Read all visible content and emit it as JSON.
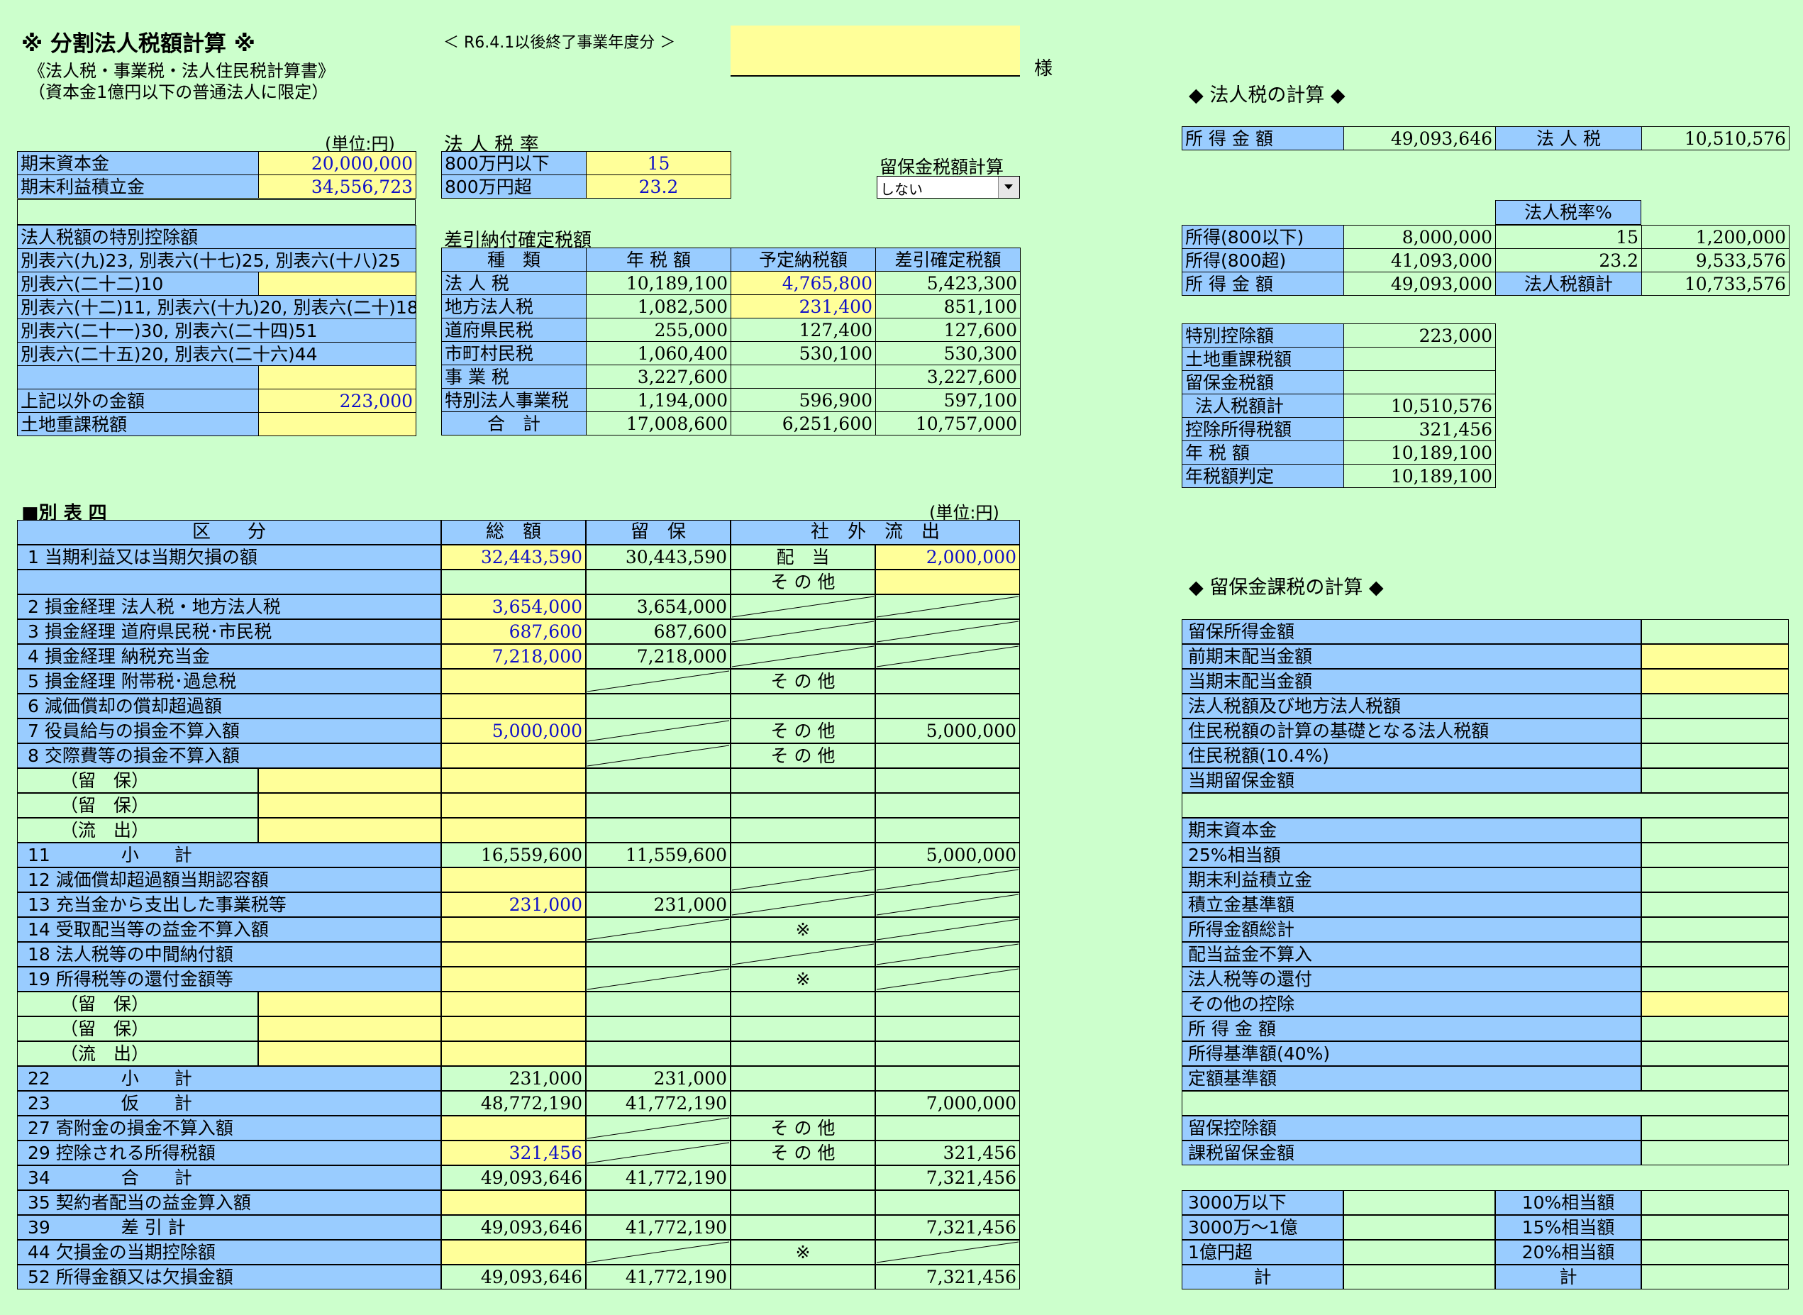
{
  "header": {
    "title": "※ 分割法人税額計算 ※",
    "subtitle1": "《法人税・事業税・法人住民税計算書》",
    "subtitle2": "（資本金1億円以下の普通法人に限定）",
    "period": "＜ R6.4.1以後終了事業年度分 ＞",
    "company_name": "",
    "honorific": "様"
  },
  "capital": {
    "unit": "(単位:円)",
    "rows": [
      {
        "label": "期末資本金",
        "value": "20,000,000"
      },
      {
        "label": "期末利益積立金",
        "value": "34,556,723"
      }
    ]
  },
  "special_deduction": {
    "title": "法人税額の特別控除額",
    "rows": [
      {
        "label": "別表六(九)23, 別表六(十七)25, 別表六(十八)25",
        "value": ""
      },
      {
        "label": "別表六(二十二)10",
        "value": ""
      },
      {
        "label": "別表六(十二)11, 別表六(十九)20, 別表六(二十)18",
        "value": ""
      },
      {
        "label": "別表六(二十一)30, 別表六(二十四)51",
        "value": ""
      },
      {
        "label": "別表六(二十五)20, 別表六(二十六)44",
        "value": ""
      },
      {
        "label": "",
        "value": ""
      },
      {
        "label": "上記以外の金額",
        "value": "223,000"
      },
      {
        "label": "土地重課税額",
        "value": ""
      }
    ]
  },
  "tax_rate": {
    "title": "法 人 税 率",
    "rows": [
      {
        "label": "800万円以下",
        "value": "15"
      },
      {
        "label": "800万円超",
        "value": "23.2"
      }
    ]
  },
  "retained_select": {
    "label": "留保金税額計算",
    "value": "しない"
  },
  "net_tax": {
    "title": "差引納付確定税額",
    "headers": [
      "種　類",
      "年 税 額",
      "予定納税額",
      "差引確定税額"
    ],
    "rows": [
      [
        "法 人 税",
        "10,189,100",
        "4,765,800",
        "5,423,300"
      ],
      [
        "地方法人税",
        "1,082,500",
        "231,400",
        "851,100"
      ],
      [
        "道府県民税",
        "255,000",
        "127,400",
        "127,600"
      ],
      [
        "市町村民税",
        "1,060,400",
        "530,100",
        "530,300"
      ],
      [
        "事 業 税",
        "3,227,600",
        "",
        "3,227,600"
      ],
      [
        "特別法人事業税",
        "1,194,000",
        "596,900",
        "597,100"
      ],
      [
        "合　計",
        "17,008,600",
        "6,251,600",
        "10,757,000"
      ]
    ]
  },
  "beppyo4": {
    "title": "■別 表 四",
    "unit": "(単位:円)",
    "headers": [
      "区　　分",
      "総　額",
      "留　保",
      "社　外　流　出"
    ],
    "rows": [
      {
        "label": "1 当期利益又は当期欠損の額",
        "total": "32,443,590",
        "retained": "30,443,590",
        "kind": "配　当",
        "outflow": "2,000,000"
      },
      {
        "label": "",
        "total": "",
        "retained": "",
        "kind": "そ の 他",
        "outflow": ""
      },
      {
        "label": "2 損金経理 法人税・地方法人税",
        "total": "3,654,000",
        "retained": "3,654,000",
        "kind": "",
        "outflow": ""
      },
      {
        "label": "3 損金経理 道府県民税･市民税",
        "total": "687,600",
        "retained": "687,600",
        "kind": "",
        "outflow": ""
      },
      {
        "label": "4 損金経理 納税充当金",
        "total": "7,218,000",
        "retained": "7,218,000",
        "kind": "",
        "outflow": ""
      },
      {
        "label": "5 損金経理 附帯税･過怠税",
        "total": "",
        "retained": "",
        "kind": "そ の 他",
        "outflow": ""
      },
      {
        "label": "6 減価償却の償却超過額",
        "total": "",
        "retained": "",
        "kind": "",
        "outflow": ""
      },
      {
        "label": "7 役員給与の損金不算入額",
        "total": "5,000,000",
        "retained": "",
        "kind": "そ の 他",
        "outflow": "5,000,000"
      },
      {
        "label": "8 交際費等の損金不算入額",
        "total": "",
        "retained": "",
        "kind": "そ の 他",
        "outflow": ""
      },
      {
        "label": "（留　保）",
        "total": "",
        "retained": "",
        "kind": "",
        "outflow": ""
      },
      {
        "label": "（留　保）",
        "total": "",
        "retained": "",
        "kind": "",
        "outflow": ""
      },
      {
        "label": "（流　出）",
        "total": "",
        "retained": "",
        "kind": "",
        "outflow": ""
      },
      {
        "label": "11　　　　小　　計",
        "total": "16,559,600",
        "retained": "11,559,600",
        "kind": "",
        "outflow": "5,000,000"
      },
      {
        "label": "12 減価償却超過額当期認容額",
        "total": "",
        "retained": "",
        "kind": "",
        "outflow": ""
      },
      {
        "label": "13 充当金から支出した事業税等",
        "total": "231,000",
        "retained": "231,000",
        "kind": "",
        "outflow": ""
      },
      {
        "label": "14 受取配当等の益金不算入額",
        "total": "",
        "retained": "",
        "kind": "※",
        "outflow": ""
      },
      {
        "label": "18 法人税等の中間納付額",
        "total": "",
        "retained": "",
        "kind": "",
        "outflow": ""
      },
      {
        "label": "19 所得税等の還付金額等",
        "total": "",
        "retained": "",
        "kind": "※",
        "outflow": ""
      },
      {
        "label": "（留　保）",
        "total": "",
        "retained": "",
        "kind": "",
        "outflow": ""
      },
      {
        "label": "（留　保）",
        "total": "",
        "retained": "",
        "kind": "",
        "outflow": ""
      },
      {
        "label": "（流　出）",
        "total": "",
        "retained": "",
        "kind": "",
        "outflow": ""
      },
      {
        "label": "22　　　　小　　計",
        "total": "231,000",
        "retained": "231,000",
        "kind": "",
        "outflow": ""
      },
      {
        "label": "23　　　　仮　　計",
        "total": "48,772,190",
        "retained": "41,772,190",
        "kind": "",
        "outflow": "7,000,000"
      },
      {
        "label": "27 寄附金の損金不算入額",
        "total": "",
        "retained": "",
        "kind": "そ の 他",
        "outflow": ""
      },
      {
        "label": "29 控除される所得税額",
        "total": "321,456",
        "retained": "",
        "kind": "そ の 他",
        "outflow": "321,456"
      },
      {
        "label": "34　　　　合　　計",
        "total": "49,093,646",
        "retained": "41,772,190",
        "kind": "",
        "outflow": "7,321,456"
      },
      {
        "label": "35 契約者配当の益金算入額",
        "total": "",
        "retained": "",
        "kind": "",
        "outflow": ""
      },
      {
        "label": "39　　　　差 引 計",
        "total": "49,093,646",
        "retained": "41,772,190",
        "kind": "",
        "outflow": "7,321,456"
      },
      {
        "label": "44 欠損金の当期控除額",
        "total": "",
        "retained": "",
        "kind": "※",
        "outflow": ""
      },
      {
        "label": "52 所得金額又は欠損金額",
        "total": "49,093,646",
        "retained": "41,772,190",
        "kind": "",
        "outflow": "7,321,456"
      }
    ]
  },
  "corp_tax_calc": {
    "title": "◆ 法人税の計算 ◆",
    "top": {
      "label1": "所 得 金 額",
      "value1": "49,093,646",
      "label2": "法 人 税",
      "value2": "10,510,576"
    },
    "rate_header": "法人税率%",
    "rows": [
      {
        "label": "所得(800以下)",
        "income": "8,000,000",
        "rate": "15",
        "tax": "1,200,000"
      },
      {
        "label": "所得(800超)",
        "income": "41,093,000",
        "rate": "23.2",
        "tax": "9,533,576"
      },
      {
        "label": "所 得 金 額",
        "income": "49,093,000",
        "rate": "法人税額計",
        "tax": "10,733,576"
      }
    ],
    "summary": [
      {
        "label": "特別控除額",
        "value": "223,000"
      },
      {
        "label": "土地重課税額",
        "value": ""
      },
      {
        "label": "留保金税額",
        "value": ""
      },
      {
        "label": " 法人税額計",
        "value": "10,510,576"
      },
      {
        "label": "控除所得税額",
        "value": "321,456"
      },
      {
        "label": "年 税 額",
        "value": "10,189,100"
      },
      {
        "label": "年税額判定",
        "value": "10,189,100"
      }
    ]
  },
  "retained_calc": {
    "title": "◆ 留保金課税の計算 ◆",
    "group1": [
      "留保所得金額",
      "前期末配当金額",
      "当期末配当金額",
      "法人税額及び地方法人税額",
      "住民税額の計算の基礎となる法人税額",
      "住民税額(10.4%)",
      "当期留保金額"
    ],
    "group2": [
      "期末資本金",
      "25%相当額",
      "期末利益積立金",
      "積立金基準額",
      "所得金額総計",
      "配当益金不算入",
      "法人税等の還付",
      "その他の控除",
      "所 得 金 額",
      "所得基準額(40%)",
      "定額基準額"
    ],
    "group3": [
      "留保控除額",
      "課税留保金額"
    ],
    "bracket": [
      {
        "label": "3000万以下",
        "rate": "10%相当額"
      },
      {
        "label": "3000万～1億",
        "rate": "15%相当額"
      },
      {
        "label": "1億円超",
        "rate": "20%相当額"
      },
      {
        "label": "計",
        "rate": "計"
      }
    ]
  }
}
